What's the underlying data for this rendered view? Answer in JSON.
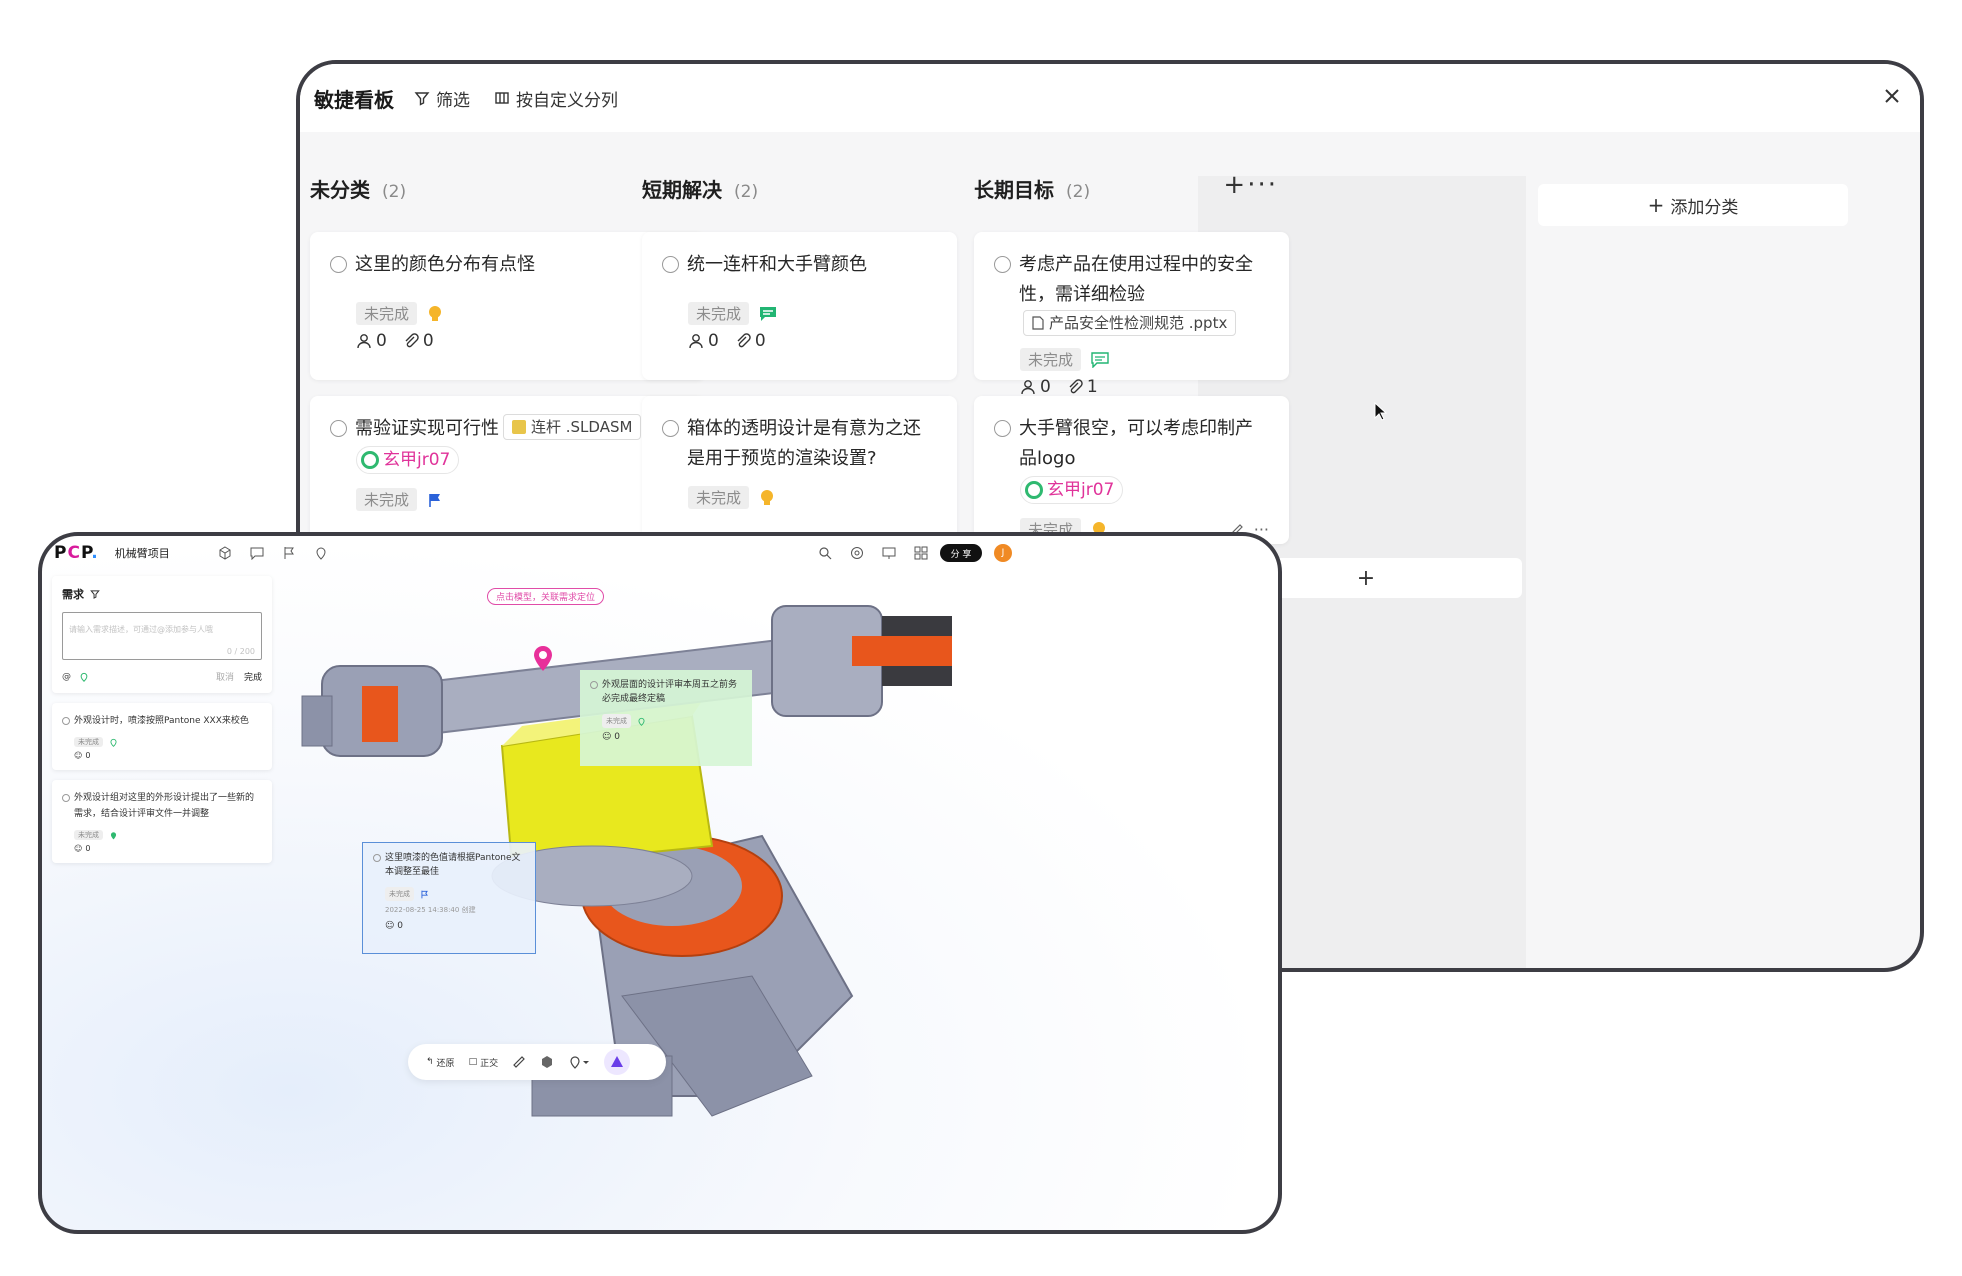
{
  "board": {
    "title": "敏捷看板",
    "filter_label": "筛选",
    "custom_columns_label": "按自定义分列",
    "add_category_label": "添加分类",
    "columns": [
      {
        "title": "未分类",
        "count": "(2)",
        "cards": [
          {
            "text": "这里的颜色分布有点怪",
            "status": "未完成",
            "icon": "lightbulb-icon",
            "members": "0",
            "attachments": "0"
          },
          {
            "text": "需验证实现可行性",
            "file": "连杆 .SLDASM",
            "user": "玄甲jr07",
            "status": "未完成",
            "icon": "flag-icon"
          }
        ]
      },
      {
        "title": "短期解决",
        "count": "(2)",
        "cards": [
          {
            "text": "统一连杆和大手臂颜色",
            "status": "未完成",
            "icon": "comment-icon",
            "members": "0",
            "attachments": "0"
          },
          {
            "text": "箱体的透明设计是有意为之还是用于预览的渲染设置?",
            "status": "未完成",
            "icon": "lightbulb-icon"
          }
        ]
      },
      {
        "title": "长期目标",
        "count": "(2)",
        "actions": "+···",
        "cards": [
          {
            "text": "考虑产品在使用过程中的安全性，需详细检验",
            "file": "产品安全性检测规范 .pptx",
            "status": "未完成",
            "icon": "comment-icon",
            "members": "0",
            "attachments": "1"
          },
          {
            "text": "大手臂很空，可以考虑印制产品logo",
            "user": "玄甲jr07",
            "status": "未完成",
            "icon": "lightbulb-icon"
          }
        ]
      }
    ],
    "add_card_symbol": "+"
  },
  "viewer": {
    "logo": {
      "part1": "P",
      "part2": "C",
      "part3": "P",
      "dot": "."
    },
    "project_name": "机械臂项目",
    "share_label": "分 享",
    "avatar_letter": "J",
    "panel": {
      "title": "需求",
      "input_placeholder": "请输入需求描述，可通过@添加参与人哦",
      "input_count": "0 / 200",
      "at_symbol": "@",
      "cancel_label": "取消",
      "done_label": "完成",
      "items": [
        {
          "text": "外观设计时，喷漆按照Pantone XXX来校色",
          "status": "未完成",
          "members": "0"
        },
        {
          "text": "外观设计组对这里的外形设计提出了一些新的需求，结合设计评审文件一并调整",
          "status": "未完成",
          "members": "0"
        }
      ]
    },
    "hint": "点击模型，关联需求定位",
    "note_green": {
      "text": "外观层面的设计评审本周五之前务必完成最终定稿",
      "status": "未完成",
      "members": "0"
    },
    "note_blue": {
      "text": "这里喷漆的色值请根据Pantone文本调整至最佳",
      "status": "未完成",
      "created": "2022-08-25 14:38:40 创建",
      "members": "0"
    },
    "toolbar": {
      "restore_label": "还原",
      "ortho_label": "正交"
    }
  },
  "colors": {
    "accent_pink": "#d81b9c",
    "status_bg": "#eeeeee",
    "note_green": "#d6f5d6",
    "note_blue_border": "#5a8fd8",
    "model_orange": "#e8561c",
    "model_yellow": "#e8e81e"
  }
}
